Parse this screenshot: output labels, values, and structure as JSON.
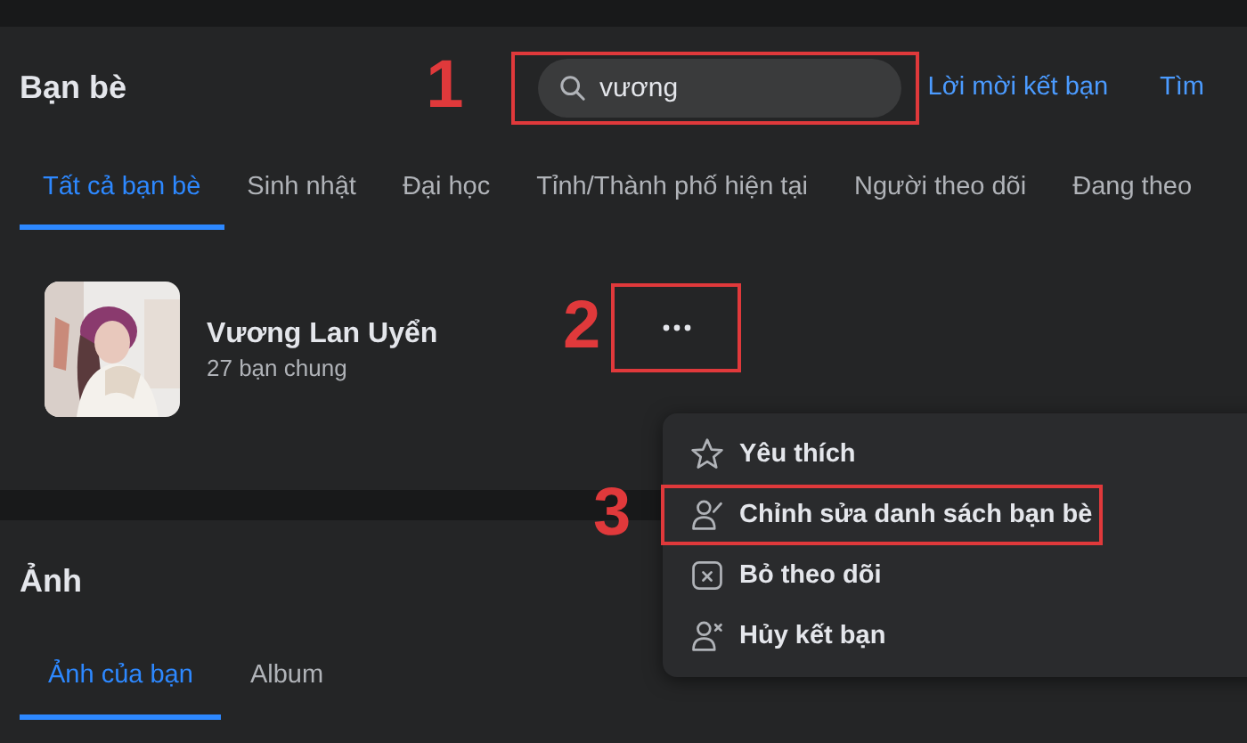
{
  "header": {
    "title": "Bạn bè",
    "search": {
      "value": "vương",
      "annotation": "1"
    },
    "links": [
      {
        "label": "Lời mời kết bạn"
      },
      {
        "label": "Tìm"
      }
    ]
  },
  "tabs": [
    {
      "label": "Tất cả bạn bè",
      "selected": true
    },
    {
      "label": "Sinh nhật",
      "selected": false
    },
    {
      "label": "Đại học",
      "selected": false
    },
    {
      "label": "Tỉnh/Thành phố hiện tại",
      "selected": false
    },
    {
      "label": "Người theo dõi",
      "selected": false
    },
    {
      "label": "Đang theo",
      "selected": false
    }
  ],
  "friends": [
    {
      "name": "Vương Lan Uyển",
      "mutual": "27 bạn chung",
      "more_annotation": "2"
    }
  ],
  "menu": {
    "items": [
      {
        "kind": "favorite",
        "label": "Yêu thích"
      },
      {
        "kind": "edit-list",
        "label": "Chỉnh sửa danh sách bạn bè",
        "annotation": "3"
      },
      {
        "kind": "unfollow",
        "label": "Bỏ theo dõi"
      },
      {
        "kind": "unfriend",
        "label": "Hủy kết bạn"
      }
    ]
  },
  "photos": {
    "title": "Ảnh",
    "tabs": [
      {
        "label": "Ảnh của bạn",
        "selected": true
      },
      {
        "label": "Album",
        "selected": false
      }
    ]
  }
}
